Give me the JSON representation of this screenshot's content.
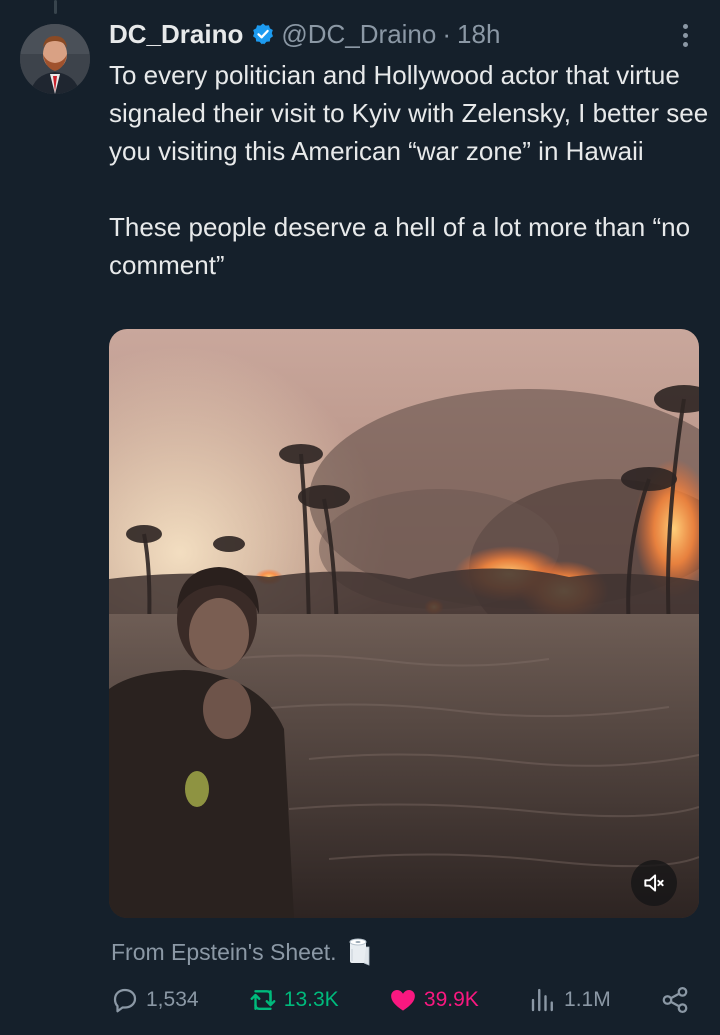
{
  "author": {
    "display_name": "DC_Draino",
    "handle": "@DC_Draino",
    "separator": "·",
    "time": "18h",
    "verified": true
  },
  "tweet": {
    "paragraphs": [
      "To every politician and Hollywood actor that virtue signaled their visit to Kyiv with Zelensky, I better see you visiting this American “war zone” in Hawaii",
      "These people deserve a hell of a lot more than “no comment”"
    ]
  },
  "media": {
    "type": "video",
    "muted": true
  },
  "source": {
    "label": "From Epstein's Sheet.",
    "icon": "toilet-paper-roll-icon"
  },
  "actions": {
    "replies": "1,534",
    "retweets": "13.3K",
    "likes": "39.9K",
    "views": "1.1M"
  },
  "colors": {
    "background": "#15202b",
    "text": "#e7e9ea",
    "secondary": "#8b98a5",
    "verified": "#1d9bf0",
    "retweet_active": "#00ba7c",
    "like_active": "#f91880"
  }
}
